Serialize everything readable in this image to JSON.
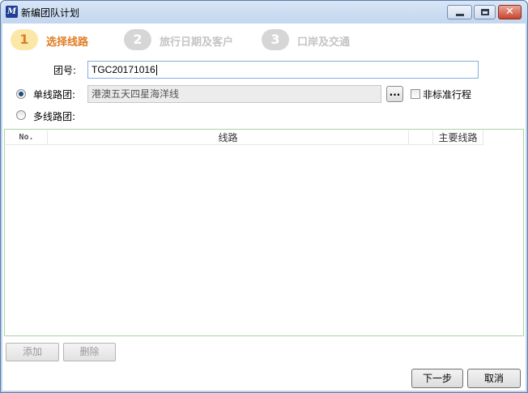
{
  "window": {
    "icon_text": "M",
    "title": "新编团队计划",
    "close_glyph": "✕"
  },
  "steps": [
    {
      "number": "1",
      "label": "选择线路",
      "state": "active"
    },
    {
      "number": "2",
      "label": "旅行日期及客户",
      "state": "inactive"
    },
    {
      "number": "3",
      "label": "口岸及交通",
      "state": "inactive"
    }
  ],
  "form": {
    "group_no_label": "团号:",
    "group_no_value": "TGC20171016",
    "single_route_label": "单线路团:",
    "single_route_value": "港澳五天四星海洋线",
    "single_route_selected": true,
    "browse_label": "...",
    "non_standard_label": "非标准行程",
    "non_standard_checked": false,
    "multi_route_label": "多线路团:",
    "multi_route_selected": false
  },
  "grid": {
    "columns": [
      "No.",
      "线路",
      "",
      "主要线路"
    ],
    "rows": []
  },
  "buttons": {
    "add": "添加",
    "delete": "删除",
    "next": "下一步",
    "cancel": "取消"
  },
  "colors": {
    "active_step": "#e07c22",
    "inactive_step": "#c4c4c4",
    "grid_border": "#a8d4a2"
  }
}
